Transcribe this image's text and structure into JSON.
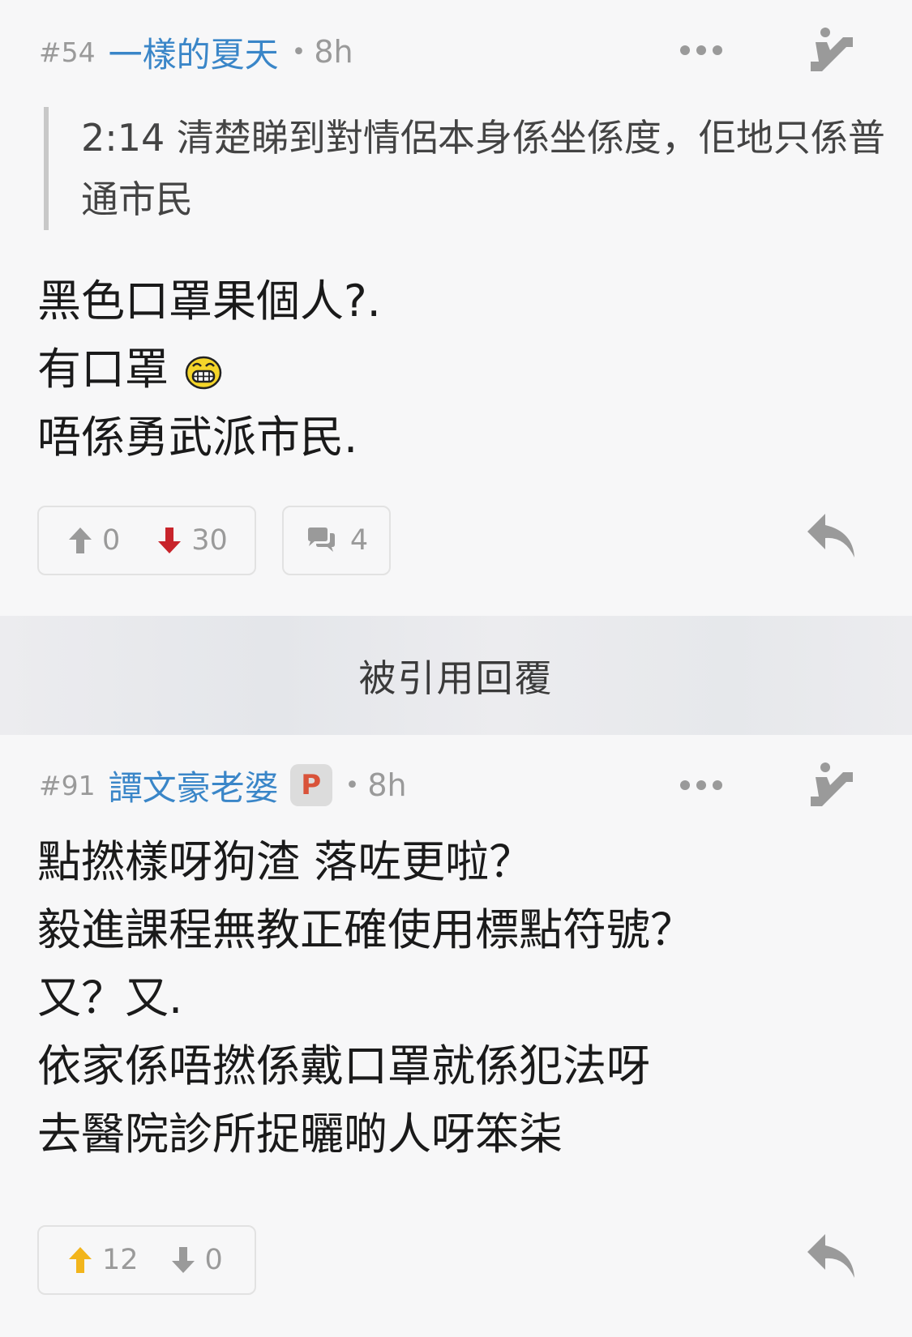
{
  "posts": [
    {
      "number": "#54",
      "author": "一樣的夏天",
      "time": "8h",
      "quote": "2:14 清楚睇到對情侶本身係坐係度，佢地只係普通市民",
      "lines": [
        "黑色口罩果個人?.",
        "有口罩",
        "唔係勇武派市民."
      ],
      "upvotes": "0",
      "downvotes": "30",
      "replies": "4"
    },
    {
      "number": "#91",
      "author": "譚文豪老婆",
      "badge": "P",
      "time": "8h",
      "lines": [
        "點撚樣呀狗渣 落咗更啦？",
        "毅進課程無教正確使用標點符號？",
        "又？又.",
        "依家係唔撚係戴口罩就係犯法呀",
        "去醫院診所捉曬啲人呀笨柒"
      ],
      "upvotes": "12",
      "downvotes": "0"
    }
  ],
  "quoted_banner": "被引用回覆",
  "icons": {
    "more": "more-dots-icon",
    "jump": "escalator-icon",
    "upvote": "arrow-up-icon",
    "downvote": "arrow-down-icon",
    "comments": "comments-icon",
    "reply": "reply-arrow-icon",
    "emoji": "grinning-face-emoji-icon"
  },
  "colors": {
    "author": "#3a86c8",
    "downvote_active": "#c8242b",
    "upvote_active": "#f2b51c",
    "badge_text": "#d9533a"
  }
}
